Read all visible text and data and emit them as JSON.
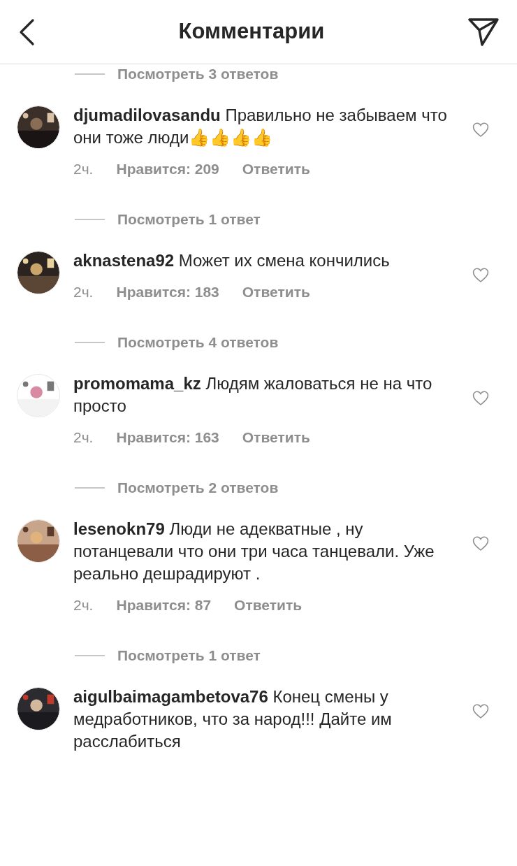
{
  "header": {
    "title": "Комментарии"
  },
  "top_replies_link": "Посмотреть 3 ответов",
  "comments": [
    {
      "username": "djumadilovasandu",
      "text": "Правильно не забываем что они тоже люди👍👍👍👍",
      "time": "2ч.",
      "likes": "Нравится: 209",
      "reply": "Ответить",
      "replies_link": "Посмотреть 1 ответ"
    },
    {
      "username": "aknastena92",
      "text": "Может их смена кончились",
      "time": "2ч.",
      "likes": "Нравится: 183",
      "reply": "Ответить",
      "replies_link": "Посмотреть 4 ответов"
    },
    {
      "username": "promomama_kz",
      "text": "Людям жаловаться не на что просто",
      "time": "2ч.",
      "likes": "Нравится: 163",
      "reply": "Ответить",
      "replies_link": "Посмотреть 2 ответов"
    },
    {
      "username": "lesenokn79",
      "text": "Люди не адекватные , ну потанцевали что они три часа танцевали. Уже реально дешрадируют .",
      "time": "2ч.",
      "likes": "Нравится: 87",
      "reply": "Ответить",
      "replies_link": "Посмотреть 1 ответ"
    },
    {
      "username": "aigulbaimagambetova76",
      "text": "Конец смены у медработников, что за народ!!! Дайте им расслабиться"
    }
  ]
}
